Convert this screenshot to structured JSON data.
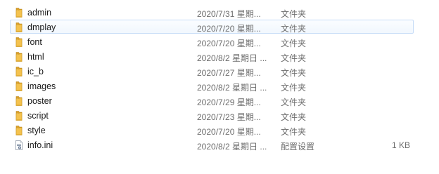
{
  "colors": {
    "folder_front": "#f4c24e",
    "folder_back": "#dba12a",
    "selection_border": "#c6dcf7",
    "meta_text": "#6d6d6d"
  },
  "files": [
    {
      "name": "admin",
      "date": "2020/7/31 星期...",
      "type": "文件夹",
      "size": "",
      "icon": "folder-icon",
      "selected": false
    },
    {
      "name": "dmplay",
      "date": "2020/7/20 星期...",
      "type": "文件夹",
      "size": "",
      "icon": "folder-icon",
      "selected": true
    },
    {
      "name": "font",
      "date": "2020/7/20 星期...",
      "type": "文件夹",
      "size": "",
      "icon": "folder-icon",
      "selected": false
    },
    {
      "name": "html",
      "date": "2020/8/2 星期日 ...",
      "type": "文件夹",
      "size": "",
      "icon": "folder-icon",
      "selected": false
    },
    {
      "name": "ic_b",
      "date": "2020/7/27 星期...",
      "type": "文件夹",
      "size": "",
      "icon": "folder-icon",
      "selected": false
    },
    {
      "name": "images",
      "date": "2020/8/2 星期日 ...",
      "type": "文件夹",
      "size": "",
      "icon": "folder-icon",
      "selected": false
    },
    {
      "name": "poster",
      "date": "2020/7/29 星期...",
      "type": "文件夹",
      "size": "",
      "icon": "folder-icon",
      "selected": false
    },
    {
      "name": "script",
      "date": "2020/7/23 星期...",
      "type": "文件夹",
      "size": "",
      "icon": "folder-icon",
      "selected": false
    },
    {
      "name": "style",
      "date": "2020/7/20 星期...",
      "type": "文件夹",
      "size": "",
      "icon": "folder-icon",
      "selected": false
    },
    {
      "name": "info.ini",
      "date": "2020/8/2 星期日 ...",
      "type": "配置设置",
      "size": "1 KB",
      "icon": "ini-file-icon",
      "selected": false
    }
  ]
}
